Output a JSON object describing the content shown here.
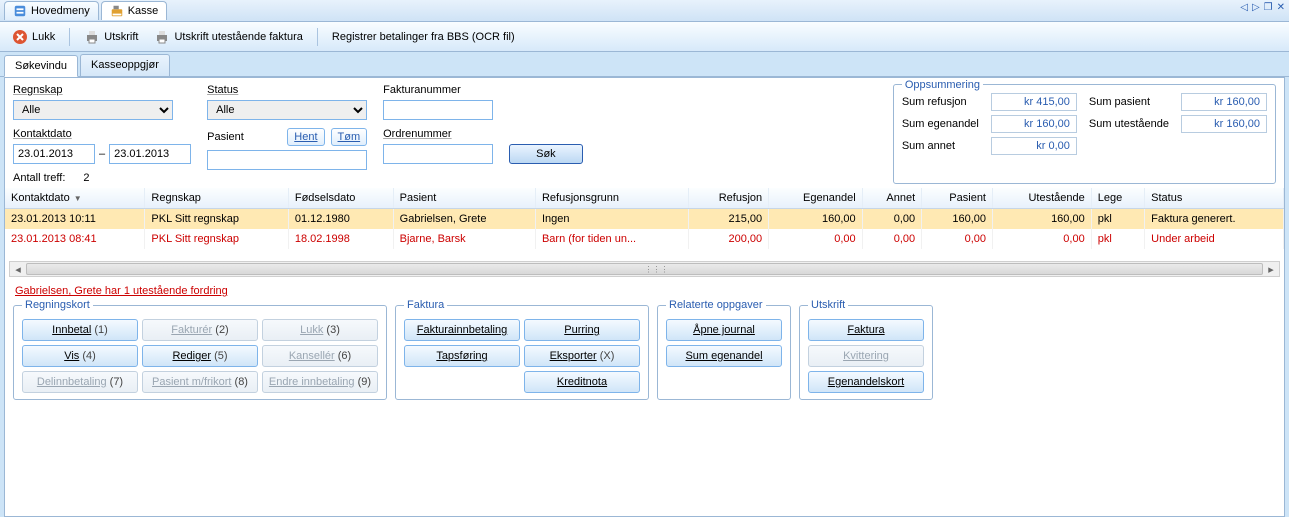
{
  "topTabs": {
    "hovedmeny": "Hovedmeny",
    "kasse": "Kasse"
  },
  "windowBtns": {
    "prev": "◁",
    "next": "▷",
    "max": "❐",
    "close": "✕"
  },
  "toolbar": {
    "lukk": "Lukk",
    "utskrift": "Utskrift",
    "utskriftUtest": "Utskrift utestående faktura",
    "registrerBBS": "Registrer betalinger fra BBS (OCR fil)"
  },
  "subTabs": {
    "sokevindu": "Søkevindu",
    "kasseoppgjor": "Kasseoppgjør"
  },
  "filters": {
    "regnskapLabel": "Regnskap",
    "regnskapValue": "Alle",
    "kontaktdatoLabel": "Kontaktdato",
    "dateFrom": "23.01.2013",
    "dateSep": "–",
    "dateTo": "23.01.2013",
    "statusLabel": "Status",
    "statusValue": "Alle",
    "pasientLabel": "Pasient",
    "hent": "Hent",
    "tom": "Tøm",
    "fakturanummerLabel": "Fakturanummer",
    "ordrenummerLabel": "Ordrenummer",
    "sok": "Søk",
    "antallTreffLabel": "Antall treff:",
    "antallTreffValue": "2"
  },
  "summary": {
    "title": "Oppsummering",
    "sumRefusjonL": "Sum refusjon",
    "sumRefusjonV": "kr 415,00",
    "sumPasientL": "Sum pasient",
    "sumPasientV": "kr 160,00",
    "sumEgenandelL": "Sum egenandel",
    "sumEgenandelV": "kr 160,00",
    "sumUtestL": "Sum utestående",
    "sumUtestV": "kr 160,00",
    "sumAnnetL": "Sum annet",
    "sumAnnetV": "kr 0,00"
  },
  "columns": {
    "kontaktdato": "Kontaktdato",
    "regnskap": "Regnskap",
    "fodselsdato": "Fødselsdato",
    "pasient": "Pasient",
    "refusjonsgrunn": "Refusjonsgrunn",
    "refusjon": "Refusjon",
    "egenandel": "Egenandel",
    "annet": "Annet",
    "pasientAmt": "Pasient",
    "utestaende": "Utestående",
    "lege": "Lege",
    "status": "Status"
  },
  "rows": [
    {
      "kontaktdato": "23.01.2013 10:11",
      "regnskap": "PKL Sitt regnskap",
      "fodselsdato": "01.12.1980",
      "pasient": "Gabrielsen, Grete",
      "refusjonsgrunn": "Ingen",
      "refusjon": "215,00",
      "egenandel": "160,00",
      "annet": "0,00",
      "pasientAmt": "160,00",
      "utestaende": "160,00",
      "lege": "pkl",
      "status": "Faktura generert."
    },
    {
      "kontaktdato": "23.01.2013 08:41",
      "regnskap": "PKL Sitt regnskap",
      "fodselsdato": "18.02.1998",
      "pasient": "Bjarne, Barsk",
      "refusjonsgrunn": "Barn (for tiden un...",
      "refusjon": "200,00",
      "egenandel": "0,00",
      "annet": "0,00",
      "pasientAmt": "0,00",
      "utestaende": "0,00",
      "lege": "pkl",
      "status": "Under arbeid"
    }
  ],
  "alert": "Gabrielsen, Grete har 1 utestående fordring",
  "groups": {
    "regningskort": {
      "title": "Regningskort",
      "innbetal": "Innbetal",
      "innbetal_hk": "(1)",
      "fakturer": "Fakturér",
      "fakturer_hk": "(2)",
      "lukk": "Lukk",
      "lukk_hk": "(3)",
      "vis": "Vis",
      "vis_hk": "(4)",
      "rediger": "Rediger",
      "rediger_hk": "(5)",
      "kanseller": "Kansellér",
      "kanseller_hk": "(6)",
      "delinnbetaling": "Delinnbetaling",
      "delinnbetaling_hk": "(7)",
      "pasientfrikort": "Pasient m/frikort",
      "pasientfrikort_hk": "(8)",
      "endreinnbetaling": "Endre innbetaling",
      "endreinnbetaling_hk": "(9)"
    },
    "faktura": {
      "title": "Faktura",
      "fakturainnbetaling": "Fakturainnbetaling",
      "purring": "Purring",
      "tapsforing": "Tapsføring",
      "eksporter": "Eksporter",
      "eksporter_hk": "(X)",
      "kreditnota": "Kreditnota"
    },
    "relaterte": {
      "title": "Relaterte oppgaver",
      "apnejournal": "Åpne journal",
      "sumegenandel": "Sum egenandel"
    },
    "utskrift": {
      "title": "Utskrift",
      "faktura": "Faktura",
      "kvittering": "Kvittering",
      "egenandelskort": "Egenandelskort"
    }
  }
}
